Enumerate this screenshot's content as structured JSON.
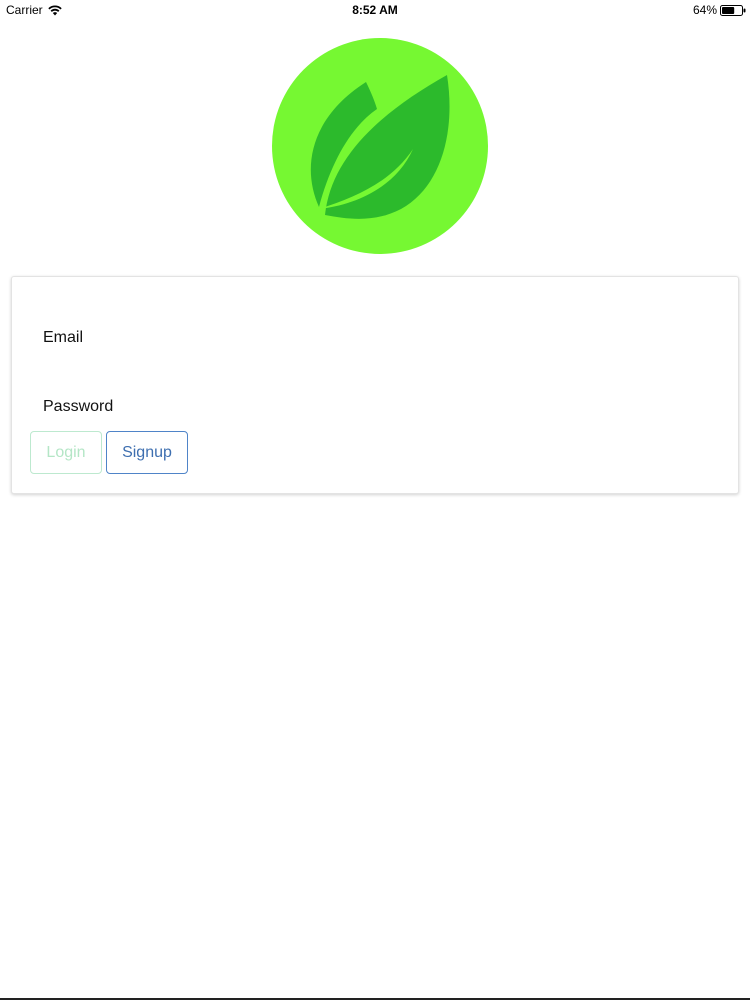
{
  "status_bar": {
    "carrier": "Carrier",
    "time": "8:52 AM",
    "battery": "64%",
    "battery_level": 0.64,
    "icons": [
      "wifi-icon",
      "battery-icon"
    ]
  },
  "logo": {
    "icon": "leaf-logo",
    "circle_color": "#76f832",
    "leaf_color": "#2cba2c"
  },
  "form": {
    "email_label": "Email",
    "email_value": "",
    "password_label": "Password",
    "password_value": "",
    "login_label": "Login",
    "signup_label": "Signup"
  },
  "colors": {
    "login_border": "#bde9cf",
    "login_text": "#b4e6c6",
    "signup_border": "#4f84c8",
    "signup_text": "#3e6fb0"
  }
}
